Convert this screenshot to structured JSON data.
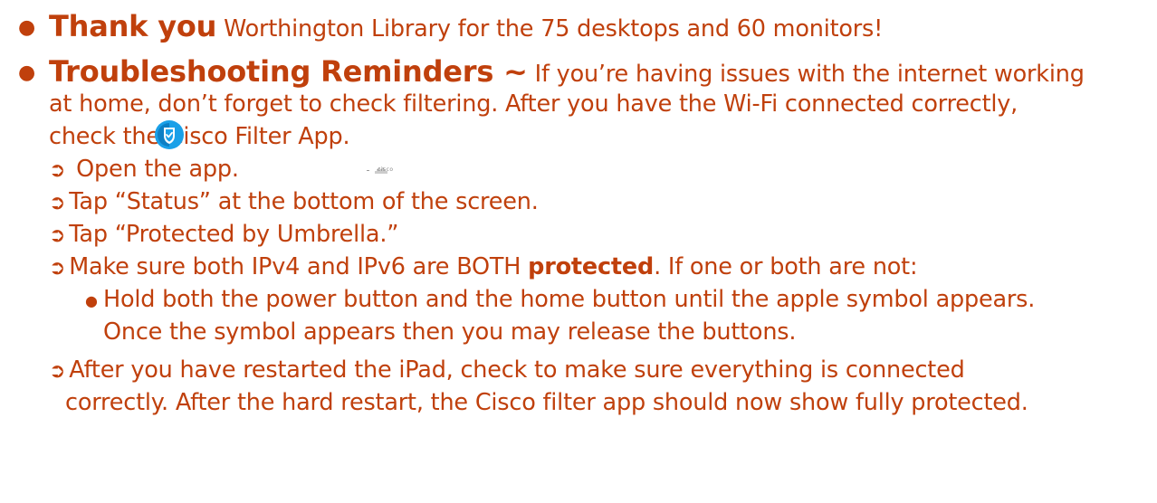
{
  "item1": {
    "heading": "Thank you",
    "text": " Worthington Library for the 75 desktops and 60 monitors!"
  },
  "item2": {
    "heading": "Troubleshooting Reminders ~",
    "line1": " If you’re having issues with the internet working",
    "line2": "at home, don’t forget to check filtering. After you have the Wi-Fi connected correctly,",
    "line3": "check the Cisco Filter App.",
    "cisco_logo_text": "cisco"
  },
  "steps": [
    {
      "arrow": "➲",
      "text": " Open the app."
    },
    {
      "arrow": "➲",
      "text": "Tap “Status” at the bottom of the screen."
    },
    {
      "arrow": "➲",
      "text": "Tap “Protected by Umbrella.”"
    },
    {
      "arrow": "➲",
      "pre": "Make sure both IPv4 and IPv6 are BOTH ",
      "bold": "protected",
      "post": ". If one or both are not:"
    }
  ],
  "substep": {
    "line1": "Hold both the power button and the home button until the apple symbol appears.",
    "line2": "Once the symbol appears then you may release the buttons."
  },
  "final_step": {
    "arrow": "➲",
    "line1": "After you have restarted the iPad, check to make sure everything is connected",
    "line2": "correctly. After the hard restart, the Cisco filter app should now show fully protected."
  },
  "colors": {
    "text": "#c0400c",
    "icon_blue": "#1aa0e8"
  }
}
